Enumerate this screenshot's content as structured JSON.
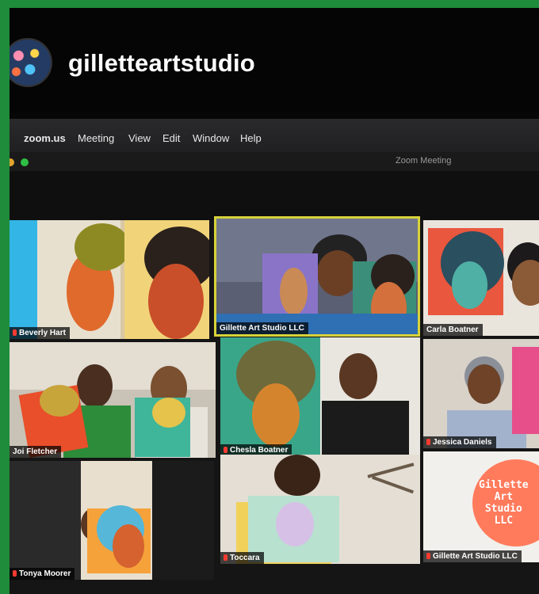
{
  "instagram": {
    "username": "gilletteartstudio"
  },
  "menubar": {
    "items": [
      "zoom.us",
      "Meeting",
      "View",
      "Edit",
      "Window",
      "Help"
    ]
  },
  "window": {
    "title": "Zoom Meeting"
  },
  "participants": [
    {
      "name": "Beverly Hart"
    },
    {
      "name": "Gillette Art Studio LLC"
    },
    {
      "name": "Carla Boatner"
    },
    {
      "name": "Joi Fletcher"
    },
    {
      "name": "Chesla Boatner"
    },
    {
      "name": "Jessica Daniels"
    },
    {
      "name": "Tonya Moorer"
    },
    {
      "name": "Toccara"
    },
    {
      "name": "Gillette Art Studio LLC"
    }
  ],
  "logo_text": "Gillette\nArt\nStudio\nLLC",
  "colors": {
    "background_green": "#1e8c3a",
    "active_speaker": "#d7d23a",
    "mic_muted": "#ff3b30"
  }
}
